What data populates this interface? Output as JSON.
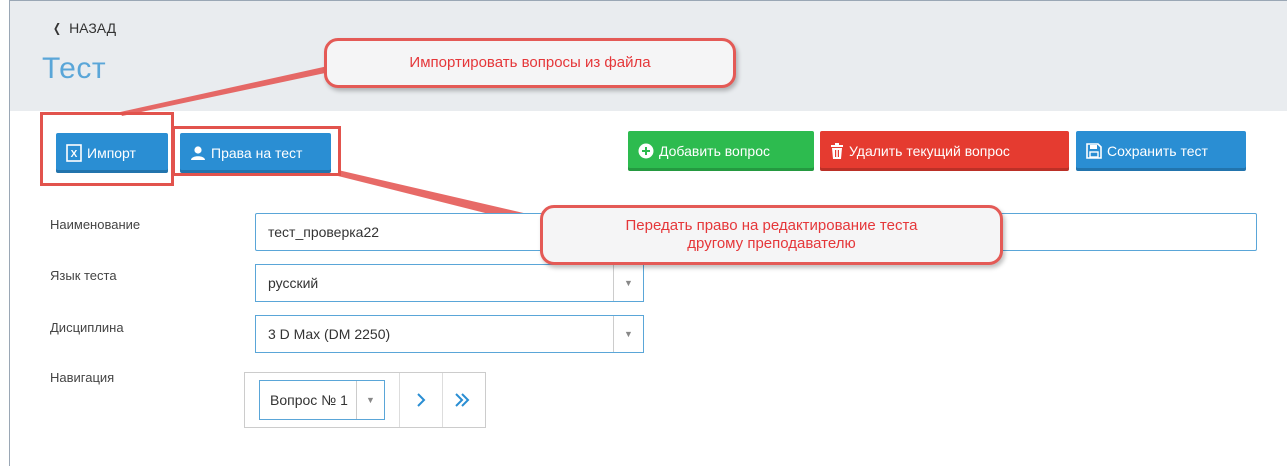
{
  "header": {
    "back_label": "НАЗАД",
    "title": "Тест"
  },
  "toolbar": {
    "import_label": "Импорт",
    "rights_label": "Права на тест",
    "add_question_label": "Добавить вопрос",
    "delete_question_label": "Удалить текущий вопрос",
    "save_test_label": "Сохранить тест"
  },
  "annotations": {
    "import_callout": "Импортировать вопросы из файла",
    "rights_callout_line1": "Передать право на редактирование теста",
    "rights_callout_line2": "другому преподавателю"
  },
  "form": {
    "name_label": "Наименование",
    "name_value": "тест_проверка22",
    "language_label": "Язык теста",
    "language_value": "русский",
    "discipline_label": "Дисциплина",
    "discipline_value": "3 D Max (DM 2250)",
    "navigation_label": "Навигация",
    "question_select_value": "Вопрос № 1"
  },
  "colors": {
    "accent_blue": "#2a8ed3",
    "green": "#2dbb4f",
    "red": "#e53b30",
    "highlight_red": "#e2534d",
    "title_blue": "#5aa6d8"
  },
  "icons": {
    "back": "chevron-left-icon",
    "import": "excel-file-icon",
    "rights": "user-icon",
    "add": "plus-circle-icon",
    "delete": "trash-icon",
    "save": "floppy-disk-icon",
    "next": "chevron-right-icon",
    "last": "double-chevron-right-icon"
  }
}
